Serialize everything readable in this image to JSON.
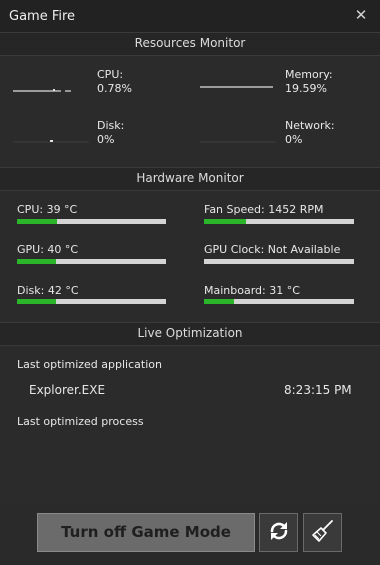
{
  "window": {
    "title": "Game Fire",
    "close_glyph": "✕"
  },
  "resources_monitor": {
    "header": "Resources Monitor",
    "items": [
      {
        "key": "cpu",
        "label": "CPU:",
        "value": "0.78%"
      },
      {
        "key": "memory",
        "label": "Memory:",
        "value": "19.59%"
      },
      {
        "key": "disk",
        "label": "Disk:",
        "value": "0%"
      },
      {
        "key": "network",
        "label": "Network:",
        "value": "0%"
      }
    ]
  },
  "hardware_monitor": {
    "header": "Hardware Monitor",
    "items": [
      {
        "key": "cpu_temp",
        "label": "CPU: 39 °C",
        "level_percent": 27
      },
      {
        "key": "fan_speed",
        "label": "Fan Speed: 1452 RPM",
        "level_percent": 28
      },
      {
        "key": "gpu_temp",
        "label": "GPU: 40 °C",
        "level_percent": 26
      },
      {
        "key": "gpu_clock",
        "label": "GPU Clock: Not Available",
        "level_percent": 0
      },
      {
        "key": "disk_temp",
        "label": "Disk: 42 °C",
        "level_percent": 26
      },
      {
        "key": "mainboard_temp",
        "label": "Mainboard: 31 °C",
        "level_percent": 20
      }
    ],
    "bar_fill_color": "#2bb52b",
    "bar_track_color": "#d4d4d4"
  },
  "live_optimization": {
    "header": "Live Optimization",
    "last_app_label": "Last optimized application",
    "last_app_name": "Explorer.EXE",
    "last_app_time": "8:23:15 PM",
    "last_process_label": "Last optimized process"
  },
  "actions": {
    "game_mode_button": "Turn off Game Mode",
    "refresh_icon": "refresh-icon",
    "cleanup_icon": "broom-icon"
  }
}
